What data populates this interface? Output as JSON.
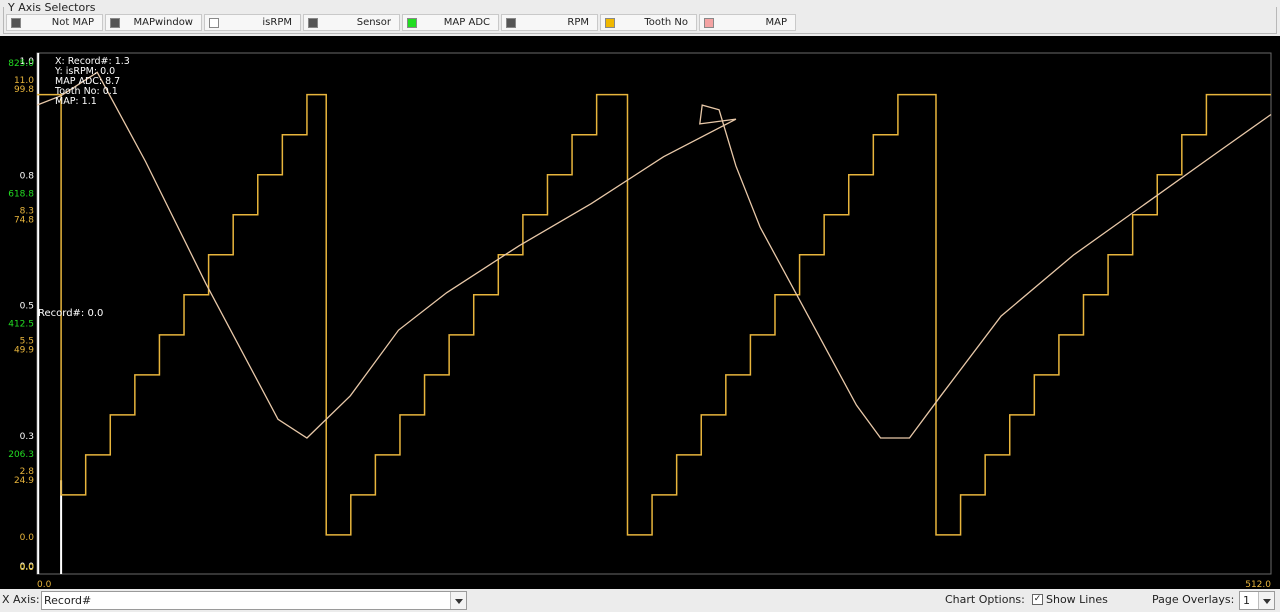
{
  "selectors": {
    "title": "Y Axis Selectors",
    "items": [
      {
        "label": "Not MAP",
        "color": "#555555"
      },
      {
        "label": "MAPwindow",
        "color": "#555555"
      },
      {
        "label": "isRPM",
        "color": "#ffffff"
      },
      {
        "label": "Sensor",
        "color": "#555555"
      },
      {
        "label": "MAP ADC",
        "color": "#22dd22"
      },
      {
        "label": "RPM",
        "color": "#555555"
      },
      {
        "label": "Tooth No",
        "color": "#f0b800"
      },
      {
        "label": "MAP",
        "color": "#f4a3a3"
      }
    ]
  },
  "yaxis": {
    "col1": [
      "1.0",
      "0.8",
      "0.5",
      "0.3",
      "0.0"
    ],
    "mapadc": [
      "825.0",
      "618.8",
      "412.5",
      "206.3",
      "0.0"
    ],
    "tooth": [
      "11.0",
      "8.3",
      "5.5",
      "2.8",
      "0.0"
    ],
    "map": [
      "99.8",
      "74.8",
      "49.9",
      "24.9",
      "0.0"
    ],
    "extra_zero": "0.0"
  },
  "xaxis_ticks": {
    "min": "0.0",
    "max": "512.0"
  },
  "tooltip": {
    "lines": [
      "X: Record#: 1.3",
      "Y: isRPM: 0.0",
      "MAP ADC: 8.7",
      "Tooth No: 0.1",
      "MAP: 1.1"
    ]
  },
  "cursor_label": "Record#: 0.0",
  "bottom": {
    "xaxis_label": "X Axis:",
    "xaxis_value": "Record#",
    "chart_options_label": "Chart Options:",
    "show_lines_label": "Show Lines",
    "show_lines_checked": true,
    "page_overlays_label": "Page Overlays:",
    "page_overlays_value": "1"
  },
  "colors": {
    "tooth": "#e8b53c",
    "map": "#e8c8a8",
    "isrpm": "#ffffff",
    "mapadc": "#22dd22",
    "plot_bg": "#000000"
  },
  "chart_data": {
    "type": "line",
    "xlim": [
      0,
      512
    ],
    "series": [
      {
        "name": "Tooth No",
        "sawtooth": {
          "max": 11,
          "step_levels": [
            0,
            1,
            2,
            3,
            4,
            5,
            6,
            7,
            8,
            9,
            10,
            11
          ],
          "drops_at_record": [
            120,
            245,
            373
          ]
        }
      },
      {
        "name": "MAP",
        "x": [
          0,
          10,
          25,
          45,
          70,
          100,
          112,
          130,
          150,
          170,
          200,
          230,
          260,
          290,
          275,
          276,
          283,
          290,
          300,
          320,
          340,
          350,
          362,
          375,
          400,
          430,
          460,
          490,
          512
        ],
        "values": [
          1.0,
          1.02,
          1.07,
          0.88,
          0.62,
          0.33,
          0.29,
          0.38,
          0.52,
          0.6,
          0.7,
          0.79,
          0.89,
          0.97,
          0.96,
          1.0,
          0.99,
          0.87,
          0.74,
          0.55,
          0.36,
          0.29,
          0.29,
          0.38,
          0.55,
          0.68,
          0.79,
          0.9,
          0.98
        ]
      },
      {
        "name": "isRPM",
        "values_note": "0 across range"
      }
    ]
  }
}
